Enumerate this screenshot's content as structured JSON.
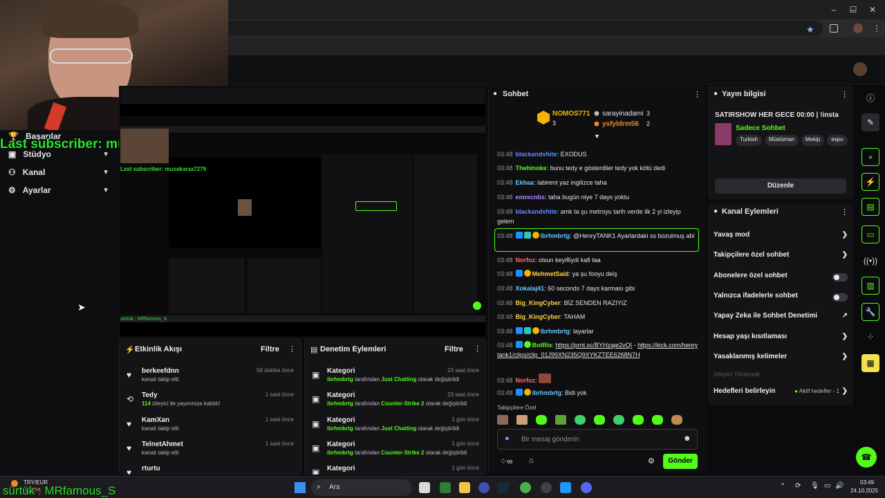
{
  "browser": {
    "window_controls": [
      "–",
      "☐",
      "✕"
    ]
  },
  "overlays": {
    "last_subscriber": "Last subscriber: musakaraa7279",
    "bottom_text": "sürtük : MRfamous_S",
    "mini_last_subscriber": "Last subscriber: musakaraa7279",
    "mini_bottom_text": "sürtük : MRfamous_S"
  },
  "nav": {
    "items": [
      {
        "label": "Başarılar",
        "icon": "trophy-icon"
      },
      {
        "label": "Stüdyo",
        "icon": "studio-icon"
      },
      {
        "label": "Kanal",
        "icon": "channel-icon"
      },
      {
        "label": "Ayarlar",
        "icon": "settings-icon"
      }
    ]
  },
  "activity": {
    "title": "Etkinlik Akışı",
    "filter": "Filtre",
    "rows": [
      {
        "name": "berkeefdnn",
        "sub": "kanalı takip etti",
        "time": "58 dakika önce",
        "icon": "heart-icon"
      },
      {
        "name": "Tedy",
        "sub_count": "114",
        "sub": " izleyici ile yayınınıza katıldı!",
        "time": "1 saat önce",
        "icon": "raid-icon"
      },
      {
        "name": "KamXan",
        "sub": "kanalı takip etti",
        "time": "1 saat önce",
        "icon": "heart-icon"
      },
      {
        "name": "TelnetAhmet",
        "sub": "kanalı takip etti",
        "time": "1 saat önce",
        "icon": "heart-icon"
      },
      {
        "name": "rturtu",
        "sub": "",
        "time": "",
        "icon": "heart-icon"
      }
    ]
  },
  "moderation": {
    "title": "Denetim Eylemleri",
    "filter": "Filtre",
    "rows": [
      {
        "name": "Kategori",
        "user": "ibrhmbrtg",
        "mid": " tarafından ",
        "cat": "Just Chatting",
        "end": " olarak değiştirildi",
        "time": "23 saat önce"
      },
      {
        "name": "Kategori",
        "user": "ibrhmbrtg",
        "mid": " tarafından ",
        "cat": "Counter-Strike 2",
        "end": " olarak değiştirildi",
        "time": "23 saat önce"
      },
      {
        "name": "Kategori",
        "user": "ibrhmbrtg",
        "mid": " tarafından ",
        "cat": "Just Chatting",
        "end": " olarak değiştirildi",
        "time": "1 gün önce"
      },
      {
        "name": "Kategori",
        "user": "ibrhmbrtg",
        "mid": " tarafından ",
        "cat": "Counter-Strike 2",
        "end": " olarak değiştirildi",
        "time": "1 gün önce"
      },
      {
        "name": "Kategori",
        "user": "",
        "mid": "",
        "cat": "",
        "end": "",
        "time": "1 gün önce"
      }
    ]
  },
  "chat": {
    "title": "Sohbet",
    "top_gifters": [
      {
        "name": "NOMOS771",
        "count": "3"
      },
      {
        "name": "sarayinadami",
        "count": "3"
      },
      {
        "name": "ysfyldrm56",
        "count": "2"
      }
    ],
    "messages": [
      {
        "time": "03:48",
        "user": "blackandvhite",
        "color": "#5b8cff",
        "text": "EXODUS"
      },
      {
        "time": "03:48",
        "user": "Thehinoke",
        "color": "#53fc18",
        "text": "bunu tedy e gösterdiler tedy yok kötü dedi"
      },
      {
        "time": "03:48",
        "user": "Ekhaa",
        "color": "#66c7ff",
        "text": "labirent yaz ingilizce taha"
      },
      {
        "time": "03:48",
        "user": "emrecnbs",
        "color": "#b084ff",
        "text": "taha bugün niye 7 days yoktu"
      },
      {
        "time": "03:48",
        "user": "blackandvhite",
        "color": "#5b8cff",
        "text": "amk ta şu metroyu tarih verde ilk 2 yi izleyip gelem"
      },
      {
        "time": "03:48",
        "user": "ibrhmbrtg",
        "color": "#66c7ff",
        "text": "@HenryTANK1 Ayarlardaki ss bozulmuş abi"
      },
      {
        "time": "03:48",
        "user": "Norfoz",
        "color": "#ff6b6b",
        "text": "olsun keyifliydi kafi taa"
      },
      {
        "time": "03:48",
        "user": "MehmetSaid",
        "color": "#ffd23f",
        "text": "ya şu fooyu deiş"
      },
      {
        "time": "03:48",
        "user": "Xokalaj41",
        "color": "#66c7ff",
        "text": "60 seconds 7 days karması gibi"
      },
      {
        "time": "03:48",
        "user": "Big_KingCyber",
        "color": "#ffd23f",
        "text": "BİZ SENDEN RAZIYIZ"
      },
      {
        "time": "03:48",
        "user": "Big_KingCyber",
        "color": "#ffd23f",
        "text": "TAHAM"
      },
      {
        "time": "03:48",
        "user": "ibrhmbrtg",
        "color": "#66c7ff",
        "text": "layarlar"
      },
      {
        "time": "03:48",
        "user": "BotRix",
        "color": "#53fc18",
        "text": "",
        "link1": "https://prnt.sc/BYHzaje2vQI",
        "sep": " - ",
        "link2": "https://kick.com/henrytank1/clips/clip_01J99XN235Q9XYKZTEE6268N7H"
      },
      {
        "time": "03:48",
        "user": "Norfoz",
        "color": "#ff6b6b",
        "text": ""
      },
      {
        "time": "03:48",
        "user": "ibrhmbrtg",
        "color": "#66c7ff",
        "text": "Bidi yok"
      }
    ],
    "followers_only": "Takipçilere Özel",
    "placeholder": "Bir mesaj gönderin",
    "send": "Gönder"
  },
  "stream_info": {
    "title": "Yayın bilgisi",
    "stream_title": "SATIRSHOW HER GECE 00:00 | !insta",
    "category": "Sadece Sohbet",
    "tags": [
      "Turkish",
      "Müslüman",
      "Mekip",
      "espo"
    ],
    "edit": "Düzenle"
  },
  "channel_actions": {
    "title": "Kanal Eylemleri",
    "items": [
      {
        "label": "Yavaş mod",
        "kind": "chevron"
      },
      {
        "label": "Takipçilere özel sohbet",
        "kind": "chevron"
      },
      {
        "label": "Abonelere özel sohbet",
        "kind": "toggle"
      },
      {
        "label": "Yalnızca ifadelerle sohbet",
        "kind": "toggle"
      },
      {
        "label": "Yapay Zeka ile Sohbet Denetimi",
        "kind": "external"
      },
      {
        "label": "Hesap yaşı kısıtlaması",
        "kind": "chevron"
      },
      {
        "label": "Yasaklanmış kelimeler",
        "kind": "chevron"
      }
    ],
    "disabled_item": "İzleyici Yönlendir",
    "targets_label": "Hedefleri belirleyin",
    "targets_status": "Aktif hedefler - 1"
  },
  "taskbar": {
    "weather_temp": "TRY/EUR",
    "weather_sub": "-0,40%",
    "search": "Ara",
    "time": "03:49",
    "date": "24.10.2025"
  },
  "colors": {
    "accent": "#53fc18",
    "panel": "#141416",
    "background": "#0b0b0d"
  }
}
